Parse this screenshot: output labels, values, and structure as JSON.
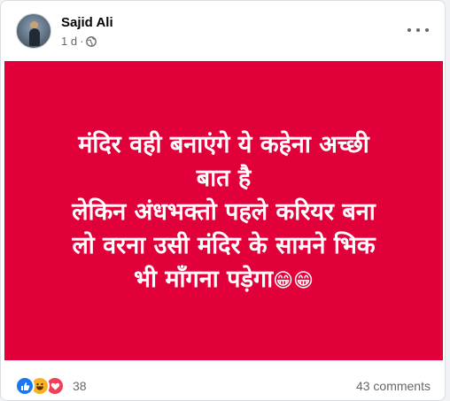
{
  "post": {
    "author_name": "Sajid Ali",
    "timestamp": "1 d",
    "separator": "·",
    "privacy_icon": "globe-icon",
    "more_icon": "more-horizontal-icon",
    "background_color": "#e2003a",
    "text_lines": [
      "मंदिर वही बनाएंगे ये कहेना अच्छी",
      "बात है",
      "लेकिन अंधभक्तो पहले करियर बना",
      "लो वरना उसी मंदिर के सामने भिक",
      "भी माँगना पड़ेगा"
    ],
    "text_emoji": "😁😁"
  },
  "footer": {
    "reaction_icons": [
      "like-icon",
      "haha-icon",
      "love-icon"
    ],
    "reaction_count": "38",
    "comments": "43 comments"
  }
}
